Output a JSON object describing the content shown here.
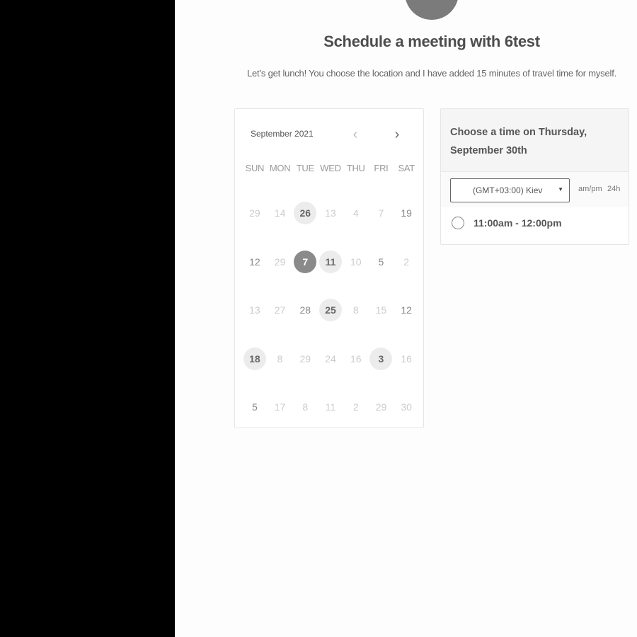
{
  "page": {
    "title": "Schedule a meeting with 6test",
    "description": "Let’s get lunch! You choose the location and I have added 15 minutes of travel time for myself."
  },
  "calendar": {
    "month_label": "September 2021",
    "prev_icon": "‹",
    "next_icon": "›",
    "weekdays": [
      "SUN",
      "MON",
      "TUE",
      "WED",
      "THU",
      "FRI",
      "SAT"
    ],
    "weeks": [
      [
        {
          "d": "29",
          "s": "dim"
        },
        {
          "d": "14",
          "s": "dim"
        },
        {
          "d": "26",
          "s": "avail"
        },
        {
          "d": "13",
          "s": "dim"
        },
        {
          "d": "4",
          "s": "dim"
        },
        {
          "d": "7",
          "s": "dim"
        },
        {
          "d": "19",
          "s": "mid"
        }
      ],
      [
        {
          "d": "12",
          "s": "mid"
        },
        {
          "d": "29",
          "s": "dim"
        },
        {
          "d": "7",
          "s": "selected"
        },
        {
          "d": "11",
          "s": "avail"
        },
        {
          "d": "10",
          "s": "dim"
        },
        {
          "d": "5",
          "s": "mid"
        },
        {
          "d": "2",
          "s": "dim"
        }
      ],
      [
        {
          "d": "13",
          "s": "dim"
        },
        {
          "d": "27",
          "s": "dim"
        },
        {
          "d": "28",
          "s": "mid"
        },
        {
          "d": "25",
          "s": "avail"
        },
        {
          "d": "8",
          "s": "dim"
        },
        {
          "d": "15",
          "s": "dim"
        },
        {
          "d": "12",
          "s": "mid"
        }
      ],
      [
        {
          "d": "18",
          "s": "avail"
        },
        {
          "d": "8",
          "s": "dim"
        },
        {
          "d": "29",
          "s": "dim"
        },
        {
          "d": "24",
          "s": "dim"
        },
        {
          "d": "16",
          "s": "dim"
        },
        {
          "d": "3",
          "s": "avail"
        },
        {
          "d": "16",
          "s": "dim"
        }
      ],
      [
        {
          "d": "5",
          "s": "mid"
        },
        {
          "d": "17",
          "s": "dim"
        },
        {
          "d": "8",
          "s": "dim"
        },
        {
          "d": "11",
          "s": "dim"
        },
        {
          "d": "2",
          "s": "dim"
        },
        {
          "d": "29",
          "s": "dim"
        },
        {
          "d": "30",
          "s": "dim"
        }
      ]
    ]
  },
  "times": {
    "header": "Choose a time on Thursday, September 30th",
    "timezone_value": "(GMT+03:00) Kiev",
    "format_ampm": "am/pm",
    "format_24h": "24h",
    "slots": [
      "11:00am - 12:00pm"
    ]
  },
  "colors": {
    "selected_day": "#8a8a8a",
    "available_day": "#ececec",
    "avatar": "#7b7b7b"
  }
}
